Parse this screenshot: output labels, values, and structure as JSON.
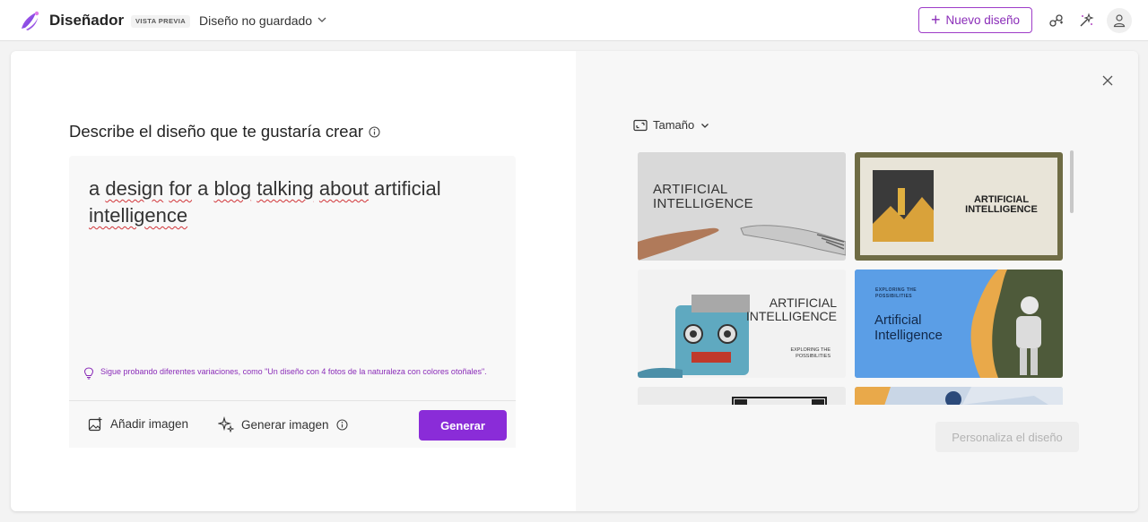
{
  "header": {
    "app_name": "Diseñador",
    "preview_badge": "VISTA PREVIA",
    "doc_title": "Diseño no guardado",
    "new_design_label": "Nuevo diseño"
  },
  "prompt": {
    "heading": "Describe el diseño que te gustaría crear",
    "words": [
      {
        "t": "a ",
        "sp": false
      },
      {
        "t": "design",
        "sp": true
      },
      {
        "t": " ",
        "sp": false
      },
      {
        "t": "for",
        "sp": true
      },
      {
        "t": " a ",
        "sp": false
      },
      {
        "t": "blog",
        "sp": true
      },
      {
        "t": " ",
        "sp": false
      },
      {
        "t": "talking",
        "sp": true
      },
      {
        "t": " ",
        "sp": false
      },
      {
        "t": "about",
        "sp": true
      },
      {
        "t": " artificial ",
        "sp": false
      },
      {
        "t": "intelligence",
        "sp": true
      }
    ],
    "tip": "Sigue probando diferentes variaciones, como \"Un diseño con 4 fotos de la naturaleza con colores otoñales\"."
  },
  "actions": {
    "add_image": "Añadir imagen",
    "generate_image": "Generar imagen",
    "generate": "Generar"
  },
  "right": {
    "size_label": "Tamaño",
    "customize_label": "Personaliza el diseño"
  },
  "thumbnails": {
    "t1_line1": "ARTIFICIAL",
    "t1_line2": "INTELLIGENCE",
    "t2_line1": "ARTIFICIAL",
    "t2_line2": "INTELLIGENCE",
    "t3_line1": "ARTIFICIAL",
    "t3_line2": "INTELLIGENCE",
    "t3_sub1": "EXPLORING THE",
    "t3_sub2": "POSSIBILITIES",
    "t4_kicker1": "EXPLORING THE",
    "t4_kicker2": "POSSIBILITIES",
    "t4_line1": "Artificial",
    "t4_line2": "Intelligence"
  },
  "colors": {
    "accent": "#8a2cd8",
    "accent_outline": "#9e3cc8",
    "spellcheck": "#d13438",
    "thumb4_bg": "#5b9ee6",
    "thumb2_frame": "#6f6c45"
  },
  "icons": [
    "designer-logo-icon",
    "chevron-down-icon",
    "plus-icon",
    "share-icon",
    "magic-icon",
    "user-icon",
    "info-icon",
    "lightbulb-icon",
    "add-image-icon",
    "sparkle-icon",
    "close-icon",
    "resize-icon"
  ]
}
